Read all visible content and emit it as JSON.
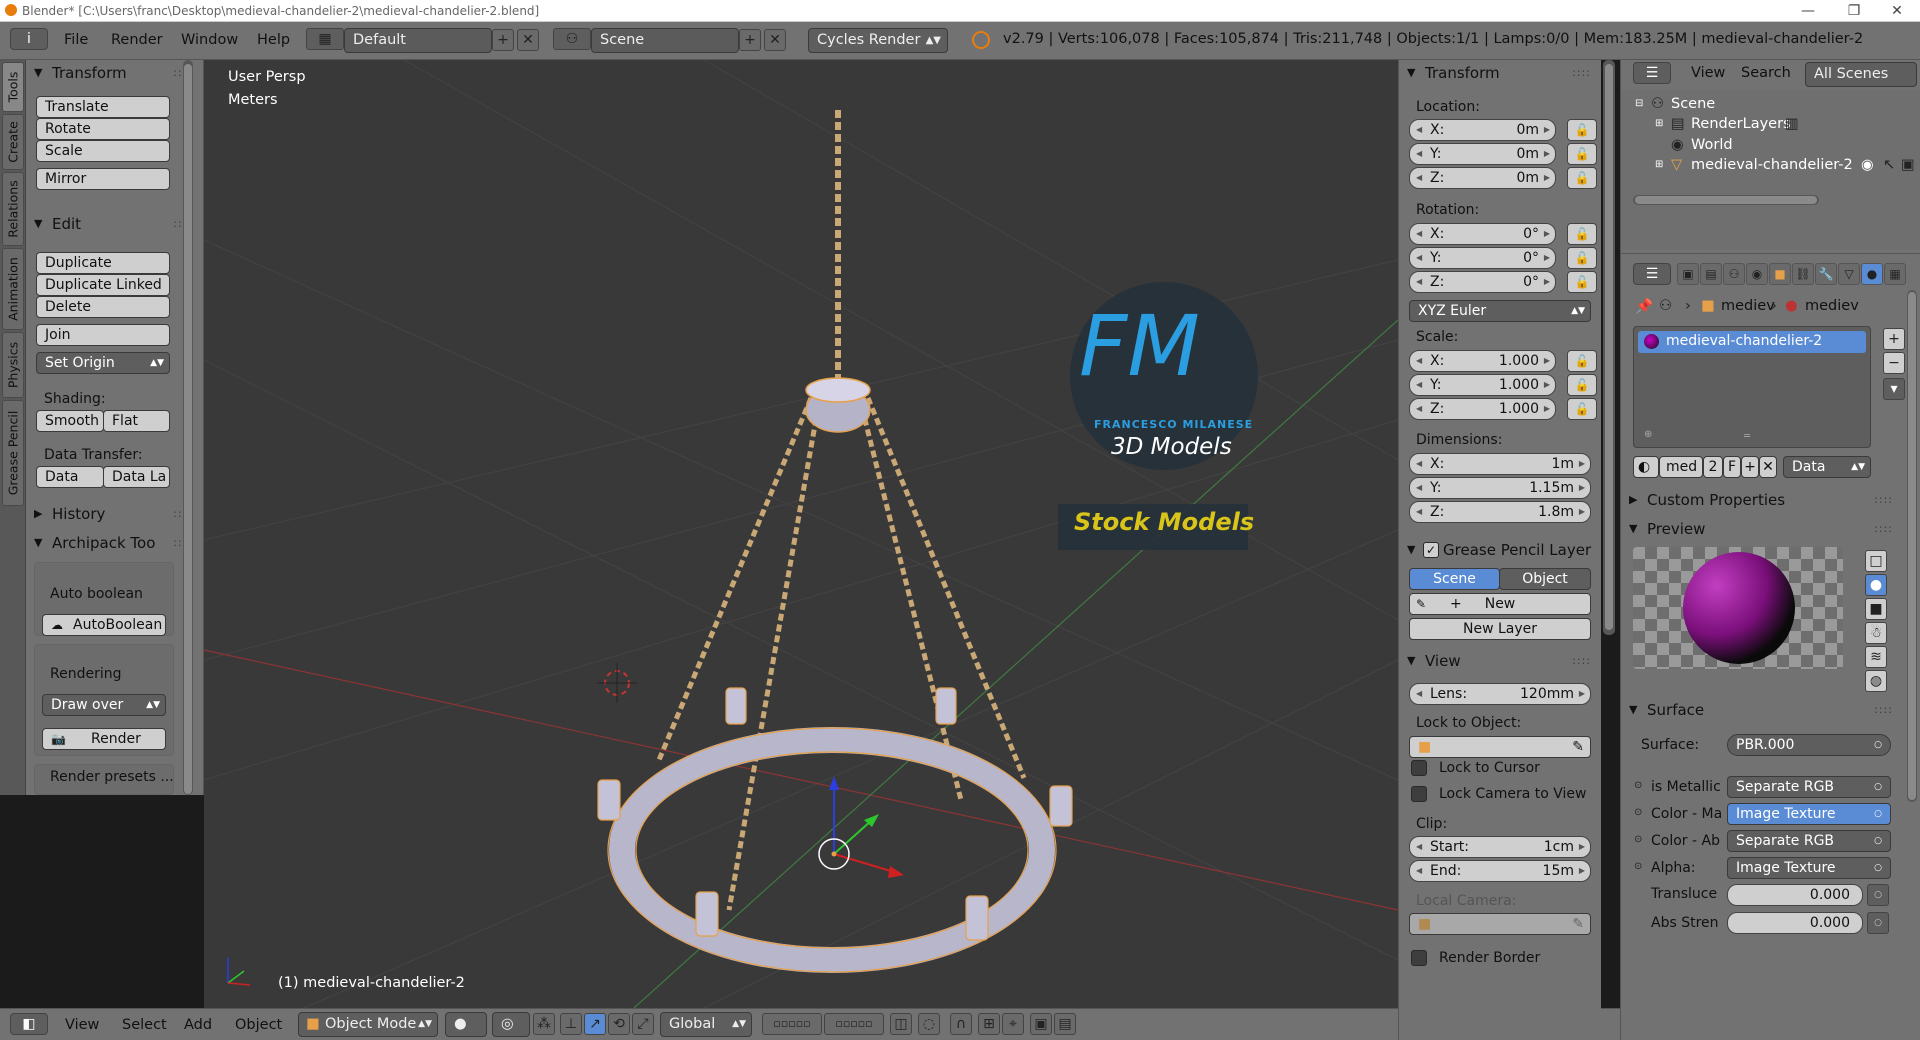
{
  "window": {
    "title": "Blender* [C:\\Users\\franc\\Desktop\\medieval-chandelier-2\\medieval-chandelier-2.blend]",
    "minimize": "—",
    "maximize": "❐",
    "close": "✕"
  },
  "menubar": {
    "info_icon": "i",
    "menus": [
      "File",
      "Render",
      "Window",
      "Help"
    ],
    "layout": "Default",
    "scene": "Scene",
    "engine": "Cycles Render",
    "stats": "v2.79 | Verts:106,078 | Faces:105,874 | Tris:211,748 | Objects:1/1 | Lamps:0/0 | Mem:183.25M | medieval-chandelier-2"
  },
  "tool_tabs": [
    "Tools",
    "Create",
    "Relations",
    "Animation",
    "Physics",
    "Grease Pencil"
  ],
  "tools": {
    "transform_header": "Transform",
    "translate": "Translate",
    "rotate": "Rotate",
    "scale": "Scale",
    "mirror": "Mirror",
    "edit_header": "Edit",
    "duplicate": "Duplicate",
    "duplicate_linked": "Duplicate Linked",
    "delete": "Delete",
    "join": "Join",
    "set_origin": "Set Origin",
    "shading_label": "Shading:",
    "smooth": "Smooth",
    "flat": "Flat",
    "data_transfer_label": "Data Transfer:",
    "data": "Data",
    "data_la": "Data La",
    "history_header": "History",
    "archipack_header": "Archipack Too",
    "auto_boolean_label": "Auto boolean",
    "auto_boolean_btn": "AutoBoolean",
    "rendering_label": "Rendering",
    "draw_over": "Draw over",
    "render_btn": "Render",
    "render_presets": "Render presets ..."
  },
  "viewport": {
    "view_name": "User Persp",
    "units": "Meters",
    "object_label": "(1) medieval-chandelier-2",
    "logo_letters": "FM",
    "logo_name": "FRANCESCO MILANESE",
    "logo_sub": "3D Models",
    "logo_banner": "Stock Models"
  },
  "bottombar": {
    "menus": [
      "View",
      "Select",
      "Add",
      "Object"
    ],
    "mode": "Object Mode",
    "orientation": "Global"
  },
  "npanel": {
    "transform_header": "Transform",
    "location_label": "Location:",
    "location": [
      {
        "axis": "X:",
        "value": "0m"
      },
      {
        "axis": "Y:",
        "value": "0m"
      },
      {
        "axis": "Z:",
        "value": "0m"
      }
    ],
    "rotation_label": "Rotation:",
    "rotation": [
      {
        "axis": "X:",
        "value": "0°"
      },
      {
        "axis": "Y:",
        "value": "0°"
      },
      {
        "axis": "Z:",
        "value": "0°"
      }
    ],
    "rotation_mode": "XYZ Euler",
    "scale_label": "Scale:",
    "scale": [
      {
        "axis": "X:",
        "value": "1.000"
      },
      {
        "axis": "Y:",
        "value": "1.000"
      },
      {
        "axis": "Z:",
        "value": "1.000"
      }
    ],
    "dimensions_label": "Dimensions:",
    "dimensions": [
      {
        "axis": "X:",
        "value": "1m"
      },
      {
        "axis": "Y:",
        "value": "1.15m"
      },
      {
        "axis": "Z:",
        "value": "1.8m"
      }
    ],
    "grease_header": "Grease Pencil Layer",
    "gp_scene": "Scene",
    "gp_object": "Object",
    "gp_new": "New",
    "gp_new_layer": "New Layer",
    "view_header": "View",
    "lens_label": "Lens:",
    "lens_value": "120mm",
    "lock_to_object": "Lock to Object:",
    "lock_to_cursor": "Lock to Cursor",
    "lock_camera": "Lock Camera to View",
    "clip_label": "Clip:",
    "clip_start_label": "Start:",
    "clip_start": "1cm",
    "clip_end_label": "End:",
    "clip_end": "15m",
    "local_camera": "Local Camera:",
    "render_border": "Render Border"
  },
  "outliner": {
    "view": "View",
    "search": "Search",
    "all_scenes": "All Scenes",
    "items": [
      "Scene",
      "RenderLayers",
      "World",
      "medieval-chandelier-2"
    ]
  },
  "properties": {
    "crumb_1": "mediev",
    "crumb_2": "mediev",
    "material_slot": "medieval-chandelier-2",
    "mat_short": "med",
    "mat_users": "2",
    "mat_fake": "F",
    "mat_link": "Data",
    "custom_props": "Custom Properties",
    "preview": "Preview",
    "surface_header": "Surface",
    "surface_label": "Surface:",
    "surface_value": "PBR.000",
    "inputs": [
      {
        "label": "is Metallic",
        "value": "Separate RGB"
      },
      {
        "label": "Color - Ma",
        "value": "Image Texture"
      },
      {
        "label": "Color - Ab",
        "value": "Separate RGB"
      },
      {
        "label": "Alpha:",
        "value": "Image Texture"
      }
    ],
    "translucency_label": "Transluce",
    "translucency_value": "0.000",
    "abs_strength_label": "Abs Stren",
    "abs_strength_value": "0.000"
  },
  "colors": {
    "panel": "#727272",
    "viewport": "#393939",
    "selection": "#5a8cd6",
    "outline": "#e6a04a",
    "chain": "#c9a876",
    "logo_blue": "#2a9ee0",
    "logo_yellow": "#d9c41a"
  }
}
